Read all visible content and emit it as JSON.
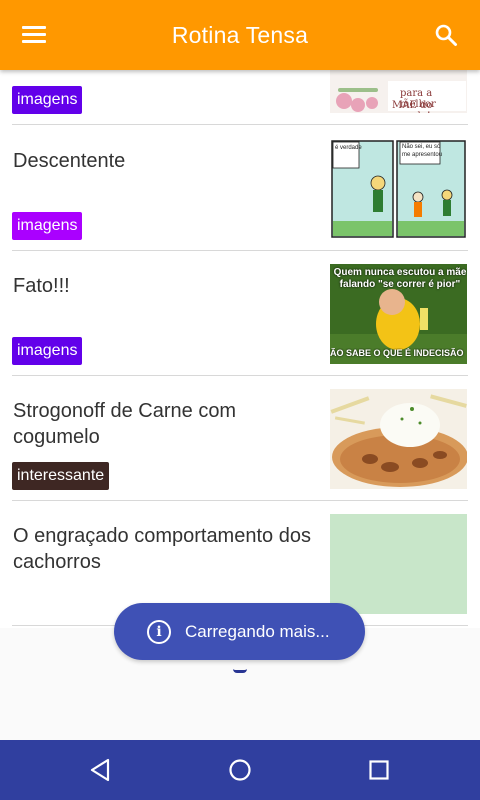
{
  "app": {
    "title": "Rotina Tensa",
    "menu_icon": "menu-icon",
    "search_icon": "search-icon",
    "accent_color": "#ff9800",
    "nav_color": "#303f9f"
  },
  "feed": {
    "items": [
      {
        "title": "",
        "tag": "imagens",
        "tag_color": "#6200ea",
        "thumb_text": [
          "para a melhor",
          "MÃE do mundo!"
        ]
      },
      {
        "title": "Descentente",
        "tag": "imagens",
        "tag_color": "#aa00ff",
        "thumb_text": [
          "é verdade",
          "Não sei, eu só",
          "me apresentou"
        ]
      },
      {
        "title": "Fato!!!",
        "tag": "imagens",
        "tag_color": "#6200ea",
        "thumb_text": [
          "Quem nunca escutou a mãe",
          "falando \"se correr é pior\"",
          "ÃO SABE O QUE É INDECISÃO"
        ]
      },
      {
        "title": "Strogonoff de Carne com cogumelo",
        "tag": "interessante",
        "tag_color": "#3e2723",
        "thumb_text": []
      },
      {
        "title": "O engraçado comportamento dos cachorros",
        "tag": "",
        "tag_color": "",
        "thumb_text": []
      }
    ]
  },
  "toast": {
    "text": "Carregando mais...",
    "icon": "info-icon"
  },
  "navbar": {
    "back_icon": "back-triangle-icon",
    "home_icon": "home-circle-icon",
    "recents_icon": "recents-square-icon"
  }
}
